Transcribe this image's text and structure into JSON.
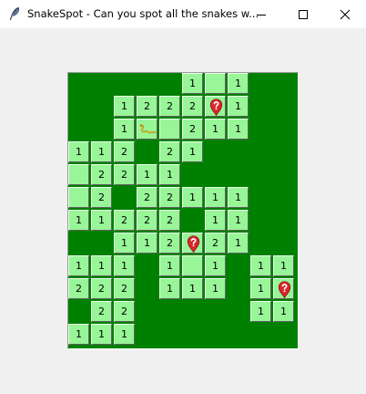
{
  "window": {
    "title": "SnakeSpot - Can you spot all the snakes w..."
  },
  "icons": {
    "app": "feather-icon",
    "minimize": "minimize-icon",
    "maximize": "maximize-icon",
    "close": "close-icon",
    "flag": "question-pin-flag-icon",
    "snake": "snake-icon"
  },
  "colors": {
    "board": "#008000",
    "cell": "#98f598",
    "flag": "#d9262c"
  },
  "board": {
    "rows": 12,
    "cols": 10,
    "cells": [
      {
        "r": 0,
        "c": 5,
        "v": "1"
      },
      {
        "r": 0,
        "c": 6,
        "v": ""
      },
      {
        "r": 0,
        "c": 7,
        "v": "1"
      },
      {
        "r": 1,
        "c": 2,
        "v": "1"
      },
      {
        "r": 1,
        "c": 3,
        "v": "2"
      },
      {
        "r": 1,
        "c": 4,
        "v": "2"
      },
      {
        "r": 1,
        "c": 5,
        "v": "2"
      },
      {
        "r": 1,
        "c": 6,
        "v": "",
        "icon": "flag"
      },
      {
        "r": 1,
        "c": 7,
        "v": "1"
      },
      {
        "r": 2,
        "c": 2,
        "v": "1"
      },
      {
        "r": 2,
        "c": 3,
        "v": "",
        "icon": "snake"
      },
      {
        "r": 2,
        "c": 4,
        "v": ""
      },
      {
        "r": 2,
        "c": 5,
        "v": "2"
      },
      {
        "r": 2,
        "c": 6,
        "v": "1"
      },
      {
        "r": 2,
        "c": 7,
        "v": "1"
      },
      {
        "r": 3,
        "c": 0,
        "v": "1"
      },
      {
        "r": 3,
        "c": 1,
        "v": "1"
      },
      {
        "r": 3,
        "c": 2,
        "v": "2"
      },
      {
        "r": 3,
        "c": 4,
        "v": "2"
      },
      {
        "r": 3,
        "c": 5,
        "v": "1"
      },
      {
        "r": 4,
        "c": 0,
        "v": ""
      },
      {
        "r": 4,
        "c": 1,
        "v": "2"
      },
      {
        "r": 4,
        "c": 2,
        "v": "2"
      },
      {
        "r": 4,
        "c": 3,
        "v": "1"
      },
      {
        "r": 4,
        "c": 4,
        "v": "1"
      },
      {
        "r": 5,
        "c": 0,
        "v": ""
      },
      {
        "r": 5,
        "c": 1,
        "v": "2"
      },
      {
        "r": 5,
        "c": 3,
        "v": "2"
      },
      {
        "r": 5,
        "c": 4,
        "v": "2"
      },
      {
        "r": 5,
        "c": 5,
        "v": "1"
      },
      {
        "r": 5,
        "c": 6,
        "v": "1"
      },
      {
        "r": 5,
        "c": 7,
        "v": "1"
      },
      {
        "r": 6,
        "c": 0,
        "v": "1"
      },
      {
        "r": 6,
        "c": 1,
        "v": "1"
      },
      {
        "r": 6,
        "c": 2,
        "v": "2"
      },
      {
        "r": 6,
        "c": 3,
        "v": "2"
      },
      {
        "r": 6,
        "c": 4,
        "v": "2"
      },
      {
        "r": 6,
        "c": 6,
        "v": "1"
      },
      {
        "r": 6,
        "c": 7,
        "v": "1"
      },
      {
        "r": 7,
        "c": 2,
        "v": "1"
      },
      {
        "r": 7,
        "c": 3,
        "v": "1"
      },
      {
        "r": 7,
        "c": 4,
        "v": "2"
      },
      {
        "r": 7,
        "c": 5,
        "v": "",
        "icon": "flag"
      },
      {
        "r": 7,
        "c": 6,
        "v": "2"
      },
      {
        "r": 7,
        "c": 7,
        "v": "1"
      },
      {
        "r": 8,
        "c": 0,
        "v": "1"
      },
      {
        "r": 8,
        "c": 1,
        "v": "1"
      },
      {
        "r": 8,
        "c": 2,
        "v": "1"
      },
      {
        "r": 8,
        "c": 4,
        "v": "1"
      },
      {
        "r": 8,
        "c": 5,
        "v": ""
      },
      {
        "r": 8,
        "c": 6,
        "v": "1"
      },
      {
        "r": 8,
        "c": 8,
        "v": "1"
      },
      {
        "r": 8,
        "c": 9,
        "v": "1"
      },
      {
        "r": 9,
        "c": 0,
        "v": "2"
      },
      {
        "r": 9,
        "c": 1,
        "v": "2"
      },
      {
        "r": 9,
        "c": 2,
        "v": "2"
      },
      {
        "r": 9,
        "c": 4,
        "v": "1"
      },
      {
        "r": 9,
        "c": 5,
        "v": "1"
      },
      {
        "r": 9,
        "c": 6,
        "v": "1"
      },
      {
        "r": 9,
        "c": 8,
        "v": "1"
      },
      {
        "r": 9,
        "c": 9,
        "v": "",
        "icon": "flag"
      },
      {
        "r": 10,
        "c": 1,
        "v": "2"
      },
      {
        "r": 10,
        "c": 2,
        "v": "2"
      },
      {
        "r": 10,
        "c": 8,
        "v": "1"
      },
      {
        "r": 10,
        "c": 9,
        "v": "1"
      },
      {
        "r": 11,
        "c": 0,
        "v": "1"
      },
      {
        "r": 11,
        "c": 1,
        "v": "1"
      },
      {
        "r": 11,
        "c": 2,
        "v": "1"
      }
    ]
  }
}
